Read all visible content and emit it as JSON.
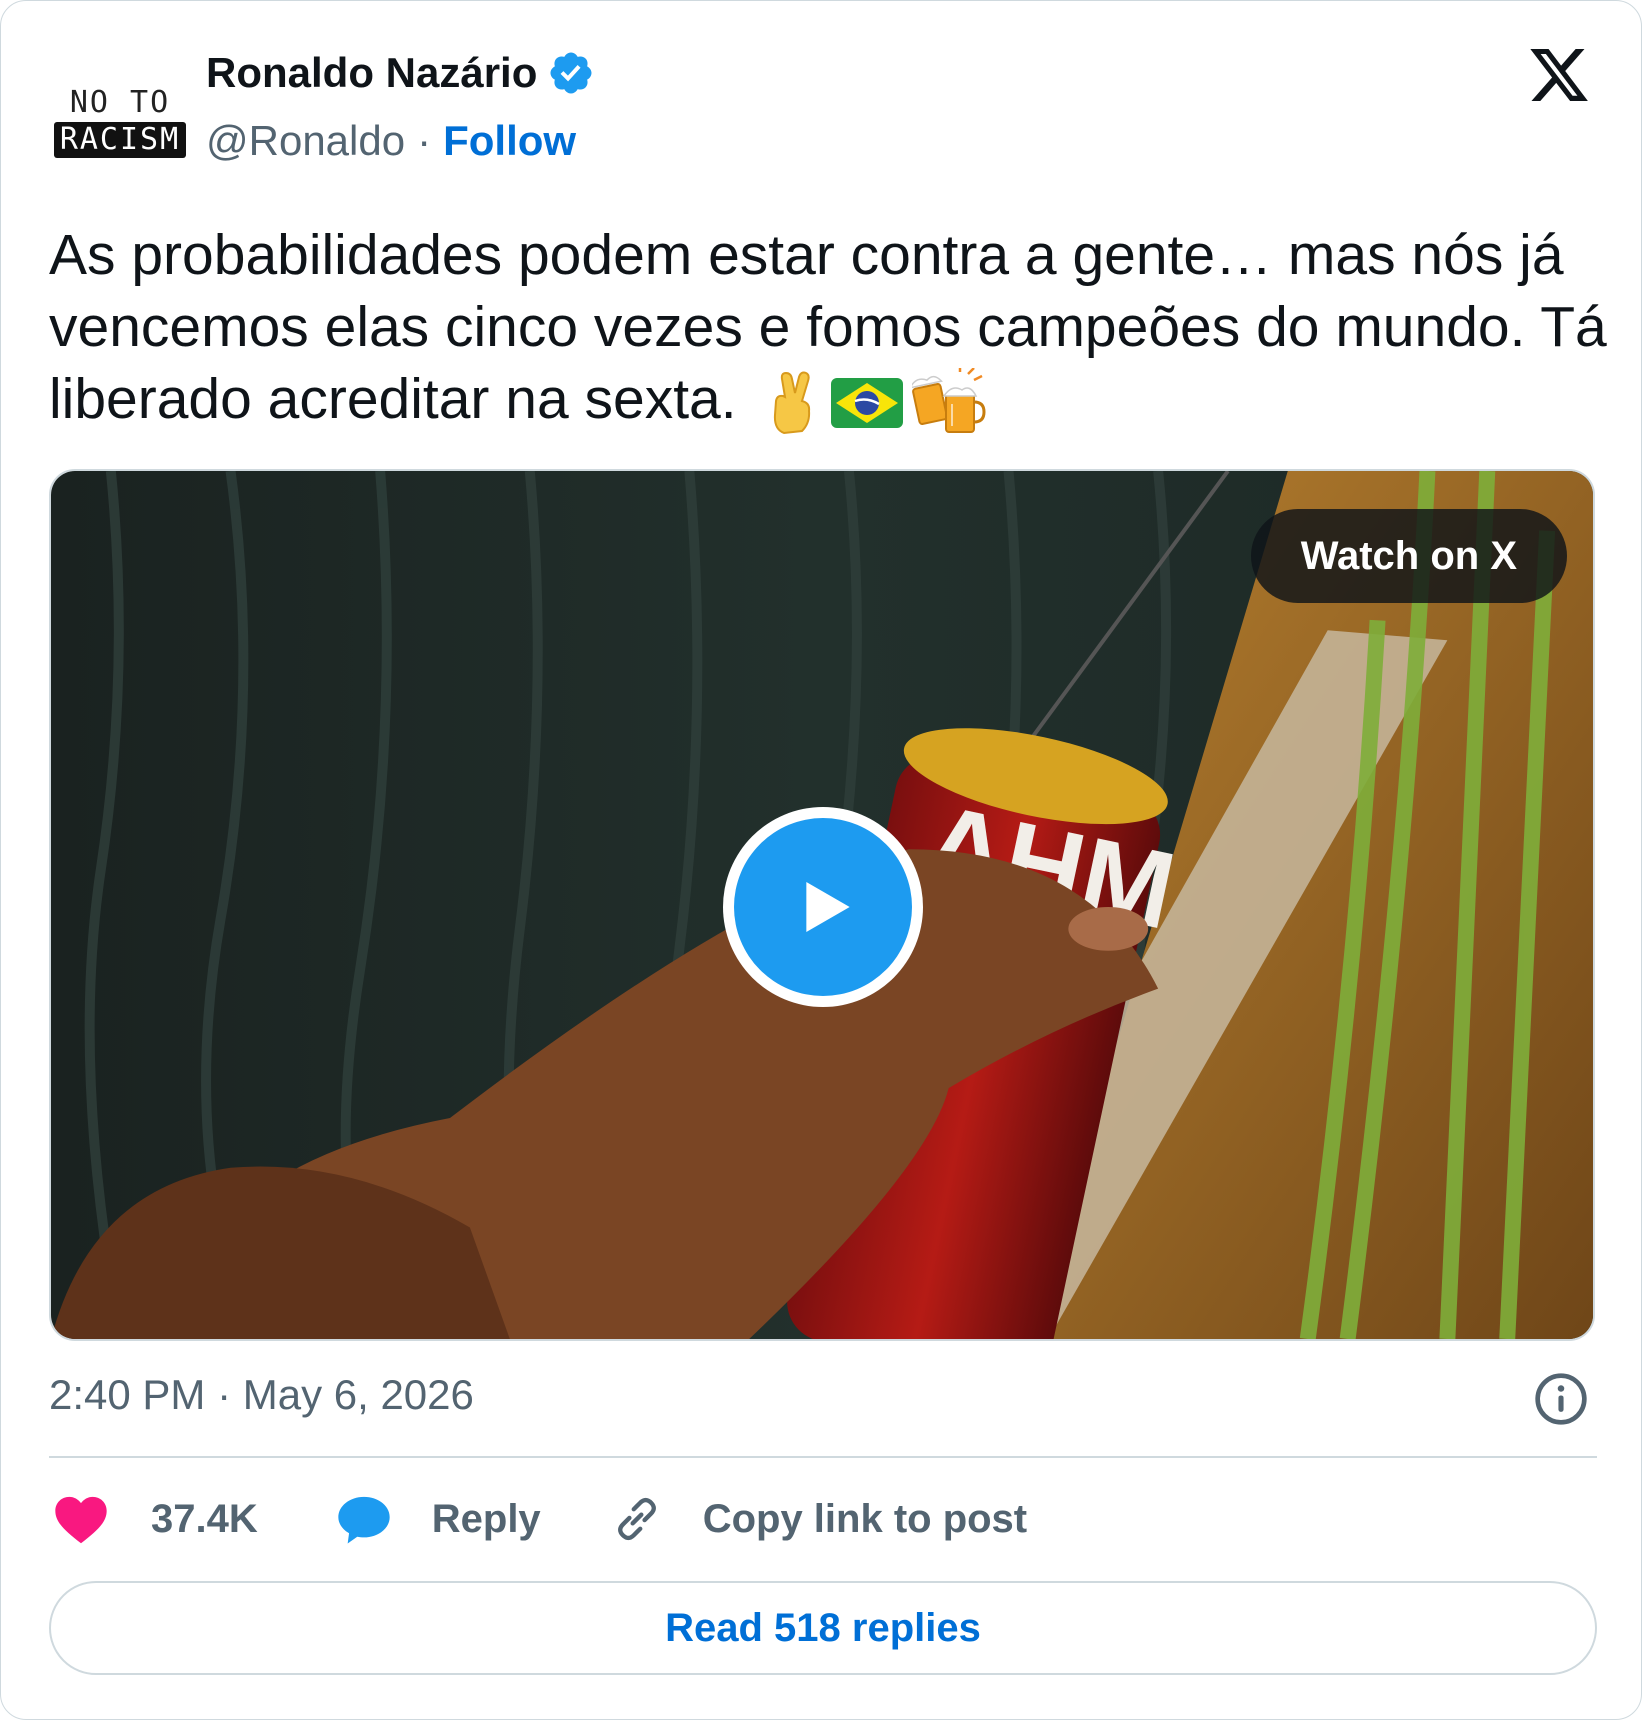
{
  "author": {
    "avatar_line1": "NO TO",
    "avatar_line2": "RACISM",
    "name": "Ronaldo Nazário",
    "verified_icon": "verified-badge-icon",
    "handle": "@Ronaldo",
    "separator": "·",
    "follow_label": "Follow"
  },
  "brand": {
    "logo_icon": "x-logo-icon"
  },
  "tweet": {
    "text": "As probabilidades podem estar contra a gente… mas nós já vencemos elas cinco vezes e fomos campeões do mundo. Tá liberado acreditar na sexta.",
    "emojis": [
      "crossed-fingers-emoji",
      "brazil-flag-emoji",
      "clinking-beer-mugs-emoji"
    ]
  },
  "media": {
    "watch_label": "Watch on X",
    "play_icon": "play-icon",
    "can_text": "AHM"
  },
  "meta": {
    "timestamp": "2:40 PM · May 6, 2026",
    "info_icon": "info-icon"
  },
  "actions": {
    "likes_count": "37.4K",
    "reply_label": "Reply",
    "copy_label": "Copy link to post"
  },
  "footer": {
    "read_replies_label": "Read 518 replies"
  },
  "colors": {
    "link_blue": "#006fd6",
    "verified_blue": "#1d9bf0",
    "heart_pink": "#f91880",
    "secondary_text": "#536471",
    "border": "#cfd9de"
  }
}
